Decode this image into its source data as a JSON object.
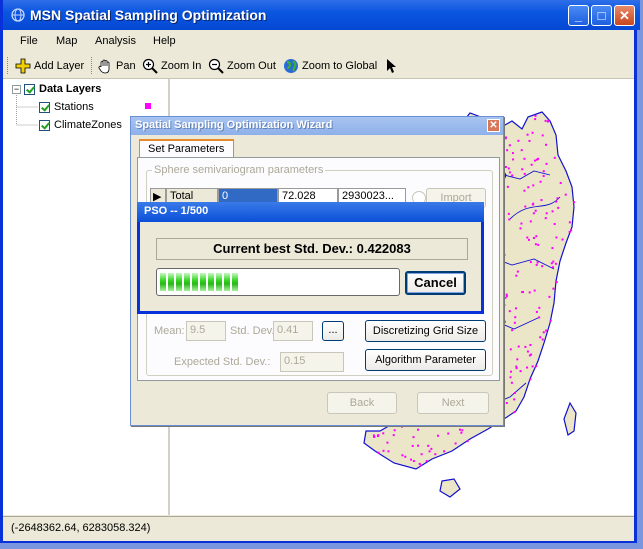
{
  "window": {
    "title": "MSN Spatial Sampling Optimization",
    "minimize": "_",
    "maximize": "□",
    "close": "✕"
  },
  "menu": [
    "File",
    "Map",
    "Analysis",
    "Help"
  ],
  "toolbar": {
    "add_layer": "Add Layer",
    "pan": "Pan",
    "zoom_in": "Zoom In",
    "zoom_out": "Zoom Out",
    "zoom_global": "Zoom to Global"
  },
  "layers": {
    "root": "Data Layers",
    "items": [
      "Stations",
      "ClimateZones"
    ],
    "station_color": "#ff00ff"
  },
  "wizard": {
    "title": "Spatial Sampling Optimization Wizard",
    "close": "✕",
    "tab": "Set Parameters",
    "group_label": "Sphere semivariogram parameters",
    "row": {
      "name": "Total",
      "nugget": "0",
      "sill": "72.028",
      "range": "2930023..."
    },
    "import": "Import",
    "mean_label": "Mean:",
    "mean_value": "9.5",
    "std_label": "Std. Dev.:",
    "std_value": "0.41",
    "ellipsis": "...",
    "grid_button": "Discretizing Grid Size",
    "algo_button": "Algorithm Parameter",
    "expected_label": "Expected Std. Dev.:",
    "expected_value": "0.15",
    "back": "Back",
    "next": "Next"
  },
  "pso": {
    "title": "PSO -- 1/500",
    "message": "Current best Std. Dev.: 0.422083",
    "progress": 0.34,
    "cancel": "Cancel"
  },
  "status": {
    "coords": "(-2648362.64, 6283058.324)"
  },
  "colors": {
    "map_land": "#ece6c8",
    "map_border": "#1010d0",
    "station": "#ff00ff"
  }
}
